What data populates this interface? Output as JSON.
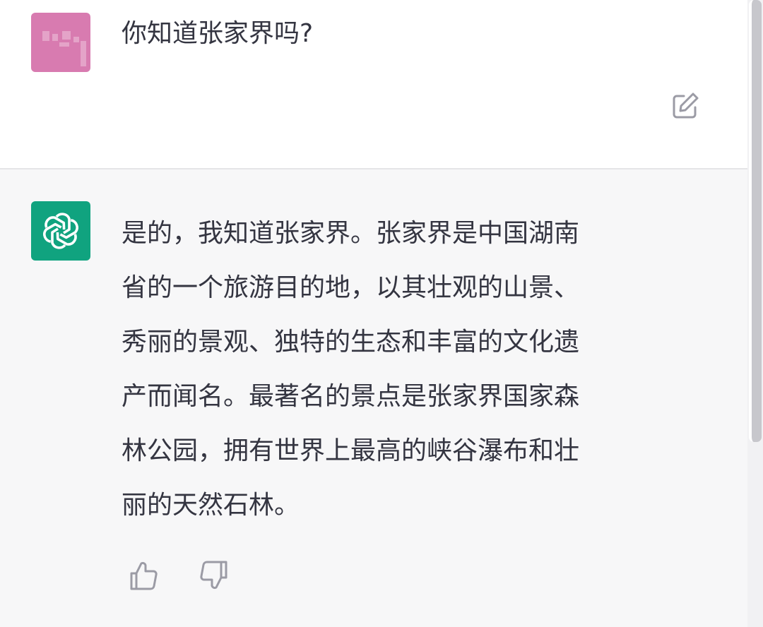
{
  "conversation": {
    "user_turn": {
      "avatar_color": "#d87bb0",
      "message": "你知道张家界吗?",
      "edit_icon": "edit-icon"
    },
    "assistant_turn": {
      "avatar_color": "#10a37f",
      "avatar_icon": "openai-logo-icon",
      "lines": [
        "是的，我知道张家界。张家界是中国湖南",
        "省的一个旅游目的地，以其壮观的山景、",
        "秀丽的景观、独特的生态和丰富的文化遗",
        "产而闻名。最著名的景点是张家界国家森",
        "林公园，拥有世界上最高的峡谷瀑布和壮",
        "丽的天然石林。"
      ],
      "feedback_icons": [
        "thumbs-up-icon",
        "thumbs-down-icon"
      ]
    }
  },
  "colors": {
    "text": "#343541",
    "icon": "#9b9ba5",
    "assistant_bg": "#f7f7f8"
  }
}
